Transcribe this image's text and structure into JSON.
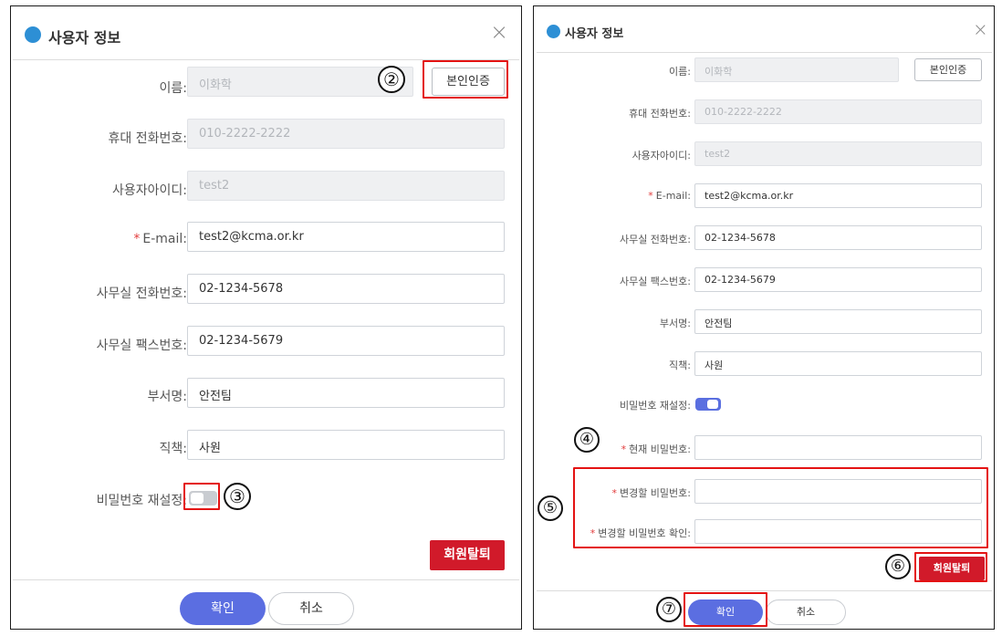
{
  "dialog": {
    "title": "사용자 정보",
    "close_glyph": "×",
    "verify_label": "본인인증",
    "withdraw_label": "회원탈퇴",
    "ok_label": "확인",
    "cancel_label": "취소",
    "fields": {
      "name": {
        "label": "이름:",
        "value": "이화학"
      },
      "mobile": {
        "label": "휴대 전화번호:",
        "value": "010-2222-2222"
      },
      "userid": {
        "label": "사용자아이디:",
        "value": "test2"
      },
      "email": {
        "label": "E-mail:",
        "value": "test2@kcma.or.kr",
        "required_mark": "*"
      },
      "office_phone": {
        "label": "사무실 전화번호:",
        "value": "02-1234-5678"
      },
      "office_fax": {
        "label": "사무실 팩스번호:",
        "value": "02-1234-5679"
      },
      "department": {
        "label": "부서명:",
        "value": "안전팀"
      },
      "position": {
        "label": "직책:",
        "value": "사원"
      },
      "pw_reset": {
        "label": "비밀번호 재설정:"
      },
      "current_pw": {
        "label": "현재 비밀번호:",
        "value": "",
        "required_mark": "*"
      },
      "new_pw": {
        "label": "변경할 비밀번호:",
        "value": "",
        "required_mark": "*"
      },
      "new_pw_confirm": {
        "label": "변경할 비밀번호 확인:",
        "value": "",
        "required_mark": "*"
      }
    }
  },
  "left_panel": {
    "password_reset_enabled": false
  },
  "right_panel": {
    "password_reset_enabled": true
  },
  "callouts": {
    "n2": "②",
    "n3": "③",
    "n4": "④",
    "n5": "⑤",
    "n6": "⑥",
    "n7": "⑦"
  },
  "colors": {
    "title_icon": "#2d8fd5",
    "required_star": "#e23b3b",
    "withdraw_button": "#d11a2a",
    "ok_button": "#5b6ee1",
    "toggle_on": "#5a6fe0",
    "toggle_off": "#c9ccd1",
    "annotation_box": "#e41313"
  }
}
